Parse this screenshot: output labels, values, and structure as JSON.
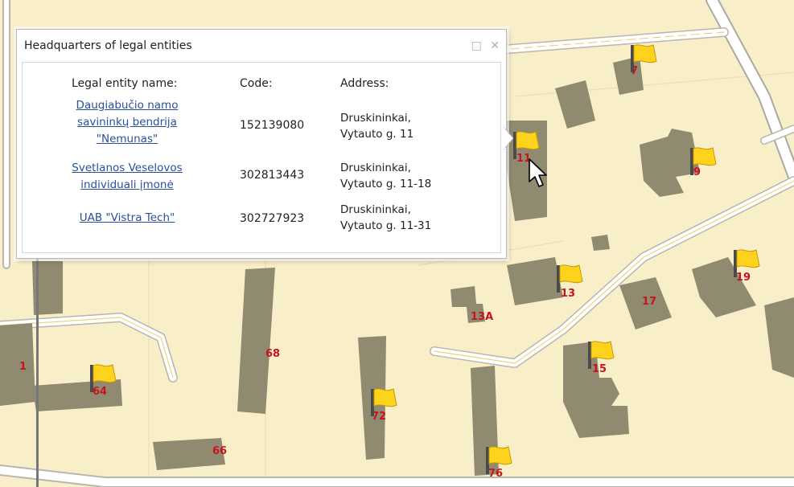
{
  "popup": {
    "title": "Headquarters of legal entities",
    "columns": {
      "name": "Legal entity name:",
      "code": "Code:",
      "address": "Address:"
    },
    "rows": [
      {
        "name_lines": [
          "Daugiabučio namo",
          "savininkų bendrija",
          "\"Nemunas\""
        ],
        "code": "152139080",
        "address_lines": [
          "Druskininkai,",
          "Vytauto g. 11"
        ]
      },
      {
        "name_lines": [
          "Svetlanos Veselovos",
          "individuali įmonė"
        ],
        "code": "302813443",
        "address_lines": [
          "Druskininkai,",
          "Vytauto g. 11-18"
        ]
      },
      {
        "name_lines": [
          "UAB \"Vistra Tech\""
        ],
        "code": "302727923",
        "address_lines": [
          "Druskininkai,",
          "Vytauto g. 11-31"
        ]
      }
    ],
    "tools": {
      "minimize_glyph": "□",
      "close_glyph": "✕"
    }
  },
  "labels": {
    "l7": "7",
    "l11": "11",
    "l9": "9",
    "l13": "13",
    "l13A": "13A",
    "l17": "17",
    "l19": "19",
    "l15": "15",
    "l1": "1",
    "l64": "64",
    "l68": "68",
    "l72": "72",
    "l66": "66",
    "l76": "76"
  },
  "colors": {
    "map_background": "#f8efc9",
    "building": "#8f8a70",
    "road": "#ffffff",
    "road_edge": "#b9b6ad",
    "label": "#c8141e",
    "flag": "#ffd21e",
    "link": "#2b4f9e"
  },
  "icons": {
    "flag": "flag-icon",
    "cursor": "mouse-cursor-icon"
  }
}
